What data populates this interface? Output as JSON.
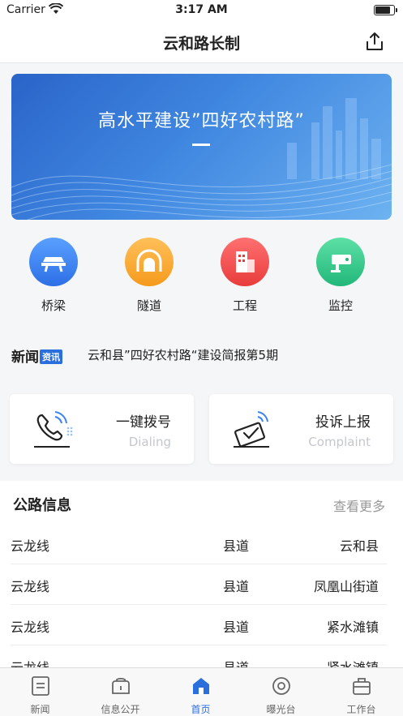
{
  "status": {
    "carrier": "Carrier",
    "time": "3:17 AM",
    "battery_level": 0.85
  },
  "nav": {
    "title": "云和路长制"
  },
  "banner": {
    "text": "高水平建设”四好农村路”"
  },
  "quick": [
    {
      "label": "桥梁",
      "icon": "bridge-icon",
      "color": "#3b82f0"
    },
    {
      "label": "隧道",
      "icon": "tunnel-icon",
      "color": "#f8a32a"
    },
    {
      "label": "工程",
      "icon": "building-icon",
      "color": "#ef4f4f"
    },
    {
      "label": "监控",
      "icon": "camera-icon",
      "color": "#33c98a"
    }
  ],
  "news": {
    "logo": "新闻",
    "tag": "资讯",
    "headline": "云和县”四好农村路“建设简报第5期"
  },
  "cards": [
    {
      "title": "一键拨号",
      "subtitle": "Dialing"
    },
    {
      "title": "投诉上报",
      "subtitle": "Complaint"
    }
  ],
  "highway": {
    "heading": "公路信息",
    "more": "查看更多",
    "rows": [
      [
        "云龙线",
        "县道",
        "云和县"
      ],
      [
        "云龙线",
        "县道",
        "凤凰山街道"
      ],
      [
        "云龙线",
        "县道",
        "紧水滩镇"
      ],
      [
        "云龙线",
        "县道",
        "紧水滩镇"
      ]
    ]
  },
  "tabs": [
    {
      "label": "新闻"
    },
    {
      "label": "信息公开"
    },
    {
      "label": "首页"
    },
    {
      "label": "曝光台"
    },
    {
      "label": "工作台"
    }
  ],
  "colors": {
    "accent": "#2b6fdc"
  }
}
